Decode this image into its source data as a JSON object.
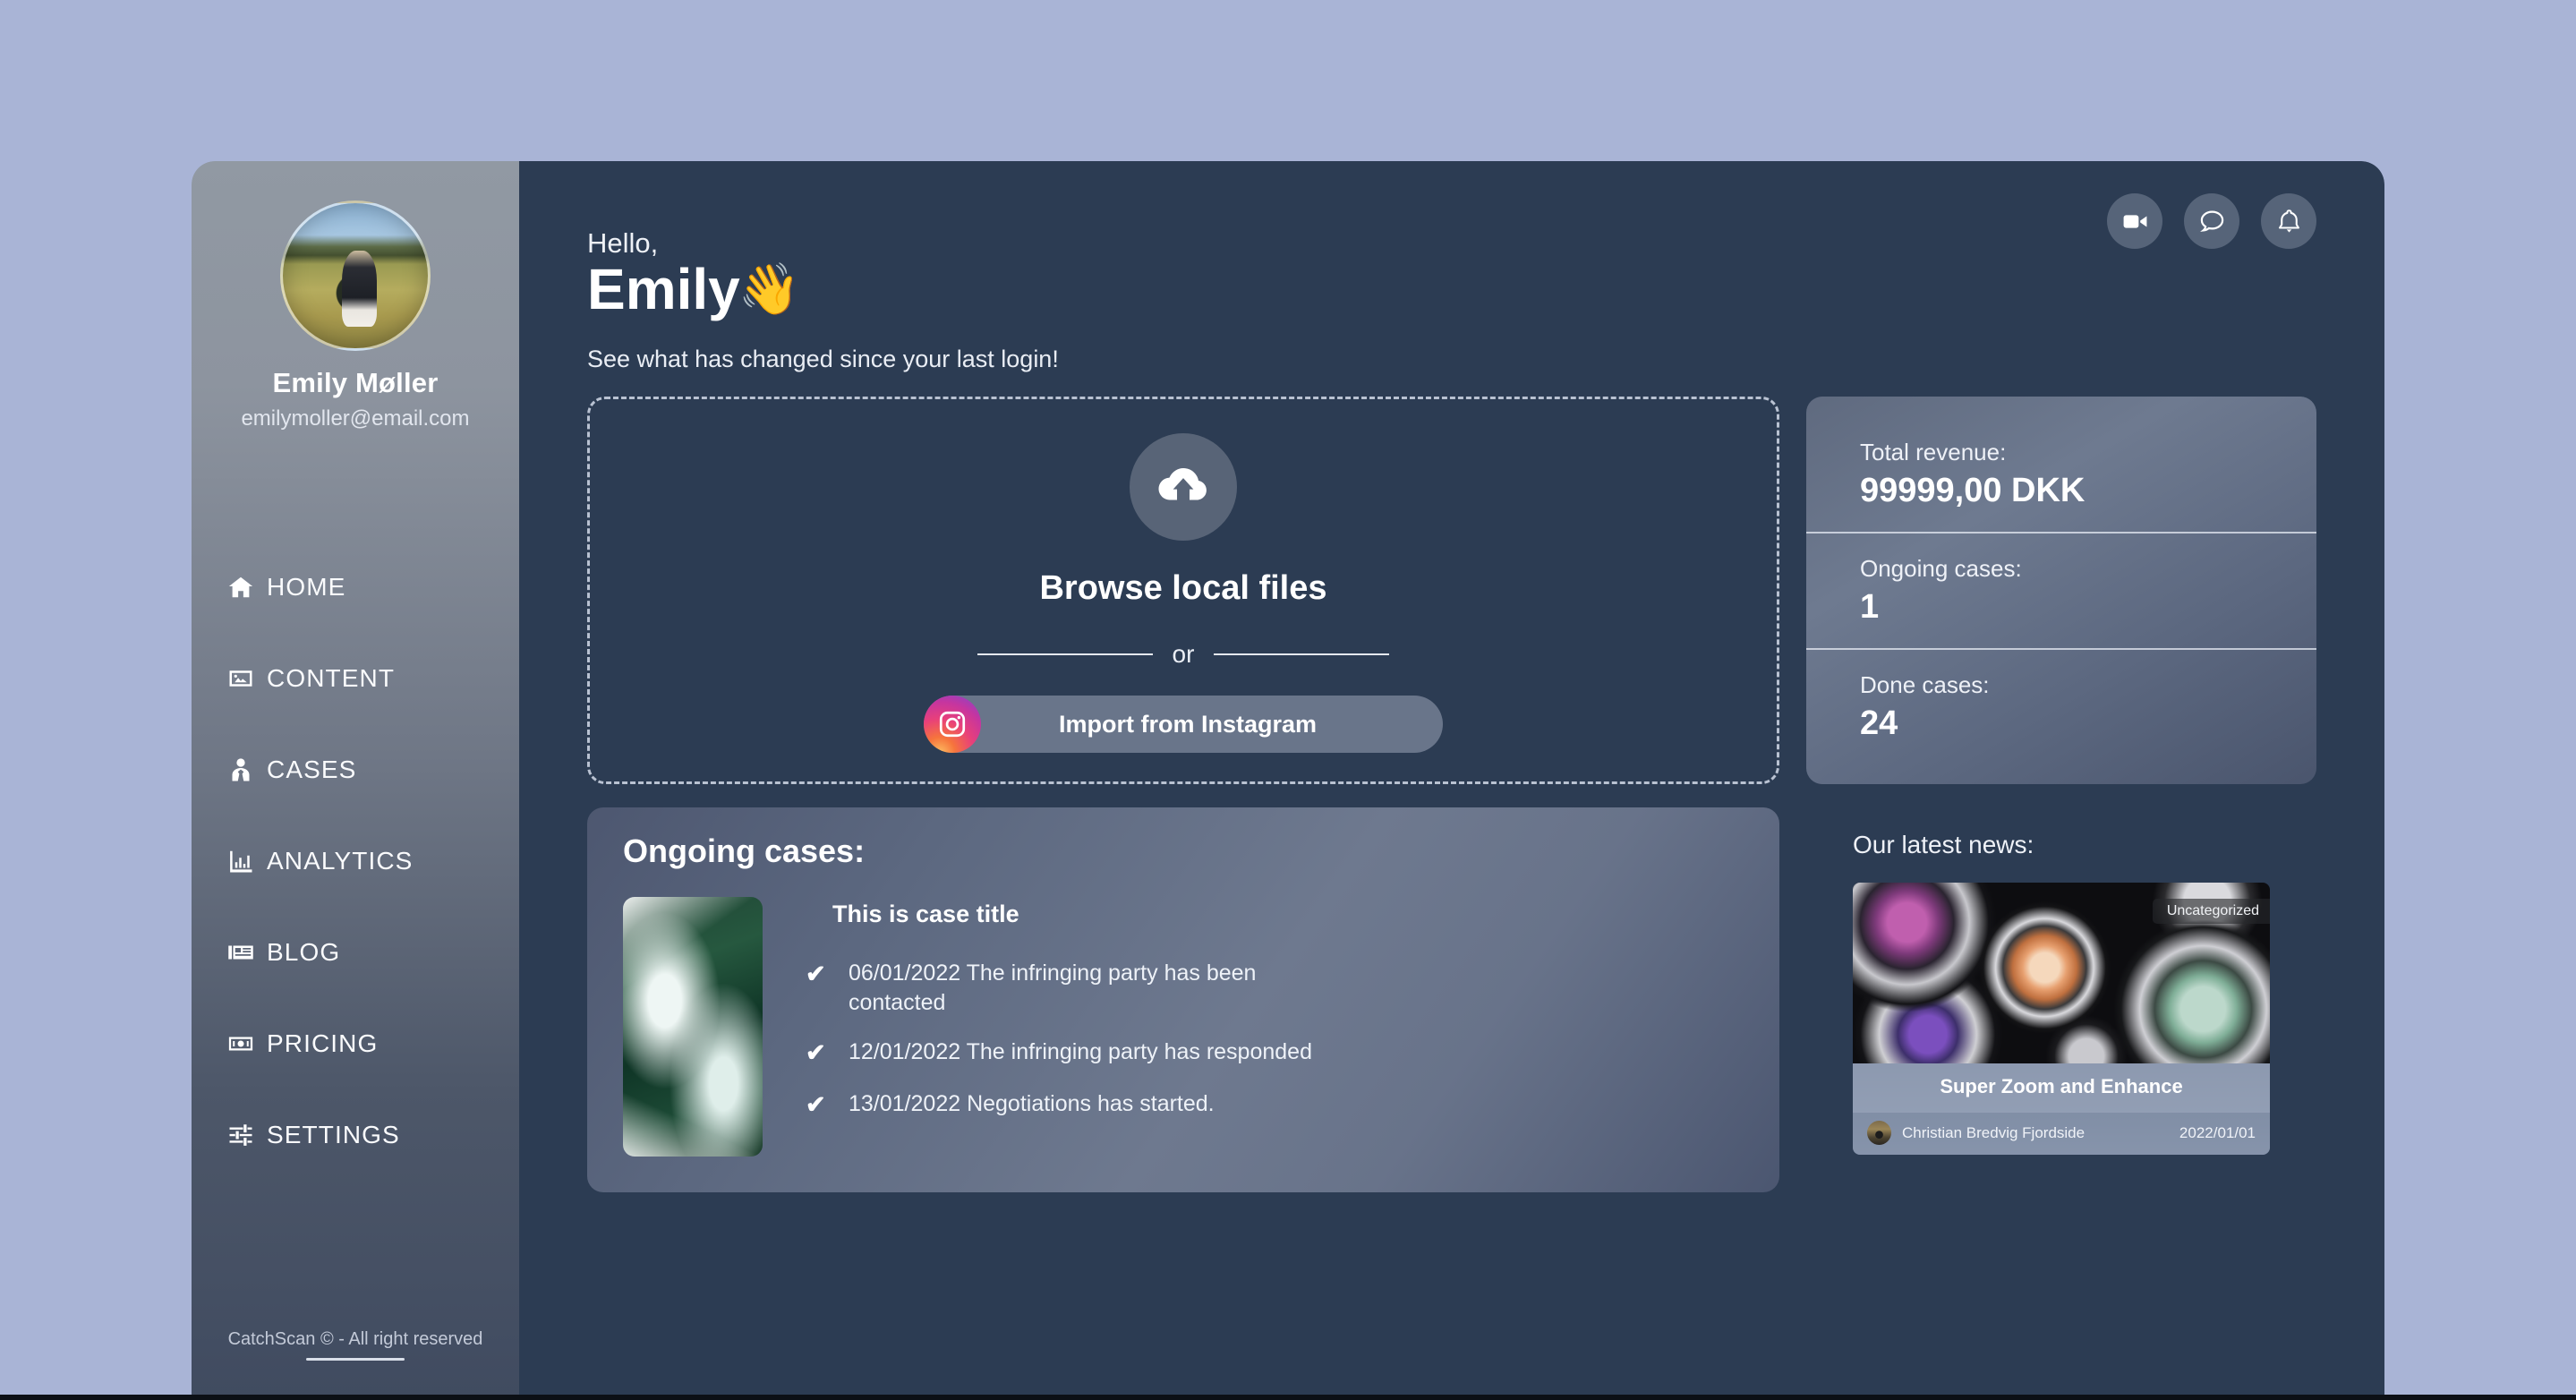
{
  "profile": {
    "name": "Emily Møller",
    "email": "emilymoller@email.com",
    "avatar_icon": "user-avatar-photo"
  },
  "sidebar": {
    "items": [
      {
        "label": "HOME",
        "icon": "home-icon"
      },
      {
        "label": "CONTENT",
        "icon": "image-icon"
      },
      {
        "label": "CASES",
        "icon": "user-tie-icon"
      },
      {
        "label": "ANALYTICS",
        "icon": "bar-chart-icon"
      },
      {
        "label": "BLOG",
        "icon": "newspaper-icon"
      },
      {
        "label": "PRICING",
        "icon": "money-bill-icon"
      },
      {
        "label": "SETTINGS",
        "icon": "sliders-icon"
      }
    ],
    "footer": "CatchScan © - All right reserved"
  },
  "topbar": {
    "buttons": [
      {
        "name": "video-camera-icon"
      },
      {
        "name": "chat-bubble-icon"
      },
      {
        "name": "bell-icon"
      }
    ]
  },
  "greeting": {
    "hello": "Hello,",
    "name": "Emily",
    "wave": "👋",
    "subtitle": "See what has changed since your last login!"
  },
  "dropzone": {
    "cloud_icon": "cloud-upload-icon",
    "title": "Browse local files",
    "or": "or",
    "instagram_icon": "instagram-icon",
    "instagram_label": "Import from Instagram"
  },
  "stats": [
    {
      "label": "Total revenue:",
      "value": "99999,00 DKK"
    },
    {
      "label": "Ongoing cases:",
      "value": "1"
    },
    {
      "label": "Done cases:",
      "value": "24"
    }
  ],
  "ongoing_cases": {
    "title": "Ongoing cases:",
    "case_title": "This is case title",
    "thumbnail_icon": "ocean-wave-photo",
    "events": [
      {
        "check": "✔",
        "text": "06/01/2022 The infringing party has been contacted"
      },
      {
        "check": "✔",
        "text": "12/01/2022 The infringing party has responded"
      },
      {
        "check": "✔",
        "text": "13/01/2022 Negotiations has started."
      }
    ]
  },
  "news": {
    "title": "Our latest news:",
    "badge": "Uncategorized",
    "headline": "Super Zoom and Enhance",
    "author": "Christian Bredvig Fjordside",
    "date": "2022/01/01",
    "image_icon": "camera-lenses-photo"
  },
  "colors": {
    "page_background": "#a9b4d6",
    "main_background": "#2c3c53",
    "sidebar_top": "#9199a3",
    "sidebar_bottom": "#404b60",
    "card": "#68738a",
    "accent_white": "#ffffff"
  }
}
